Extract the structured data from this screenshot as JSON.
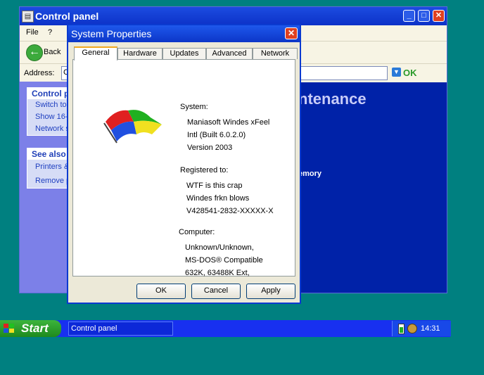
{
  "control_panel": {
    "title": "Control panel",
    "menu": [
      "File",
      "?"
    ],
    "toolbar": {
      "back_label": "Back"
    },
    "address": {
      "label": "Address:",
      "value": "C",
      "go_label": "OK"
    },
    "tasks_box": {
      "header": "Control p",
      "items": [
        "Switch to",
        "Show 16-",
        "Network s"
      ]
    },
    "see_also_box": {
      "header": "See also",
      "items": [
        "Printers &",
        "Remove p"
      ]
    },
    "heading_visible": "ntenance",
    "link_visible": "emory"
  },
  "dialog": {
    "title": "System Properties",
    "tabs": [
      "General",
      "Hardware",
      "Updates",
      "Advanced",
      "Network"
    ],
    "active_tab": "General",
    "system_label": "System:",
    "system_lines": [
      "Maniasoft Windes xFeel",
      "Intl (Built 6.0.2.0)",
      "Version 2003"
    ],
    "registered_label": "Registered to:",
    "registered_lines": [
      "WTF is this crap",
      "Windes frkn blows",
      "V428541-2832-XXXXX-X"
    ],
    "computer_label": "Computer:",
    "computer_lines": [
      "Unknown/Unknown,",
      "MS-DOS® Compatible",
      "632K, 63488K Ext,"
    ],
    "buttons": {
      "ok": "OK",
      "cancel": "Cancel",
      "apply": "Apply"
    }
  },
  "taskbar": {
    "start_label": "Start",
    "task_button": "Control panel",
    "clock": "14:31"
  },
  "colors": {
    "desktop": "#008080",
    "taskbar": "#1830f0",
    "title_bar": "#0c36c8",
    "start": "#2a9a2a"
  }
}
